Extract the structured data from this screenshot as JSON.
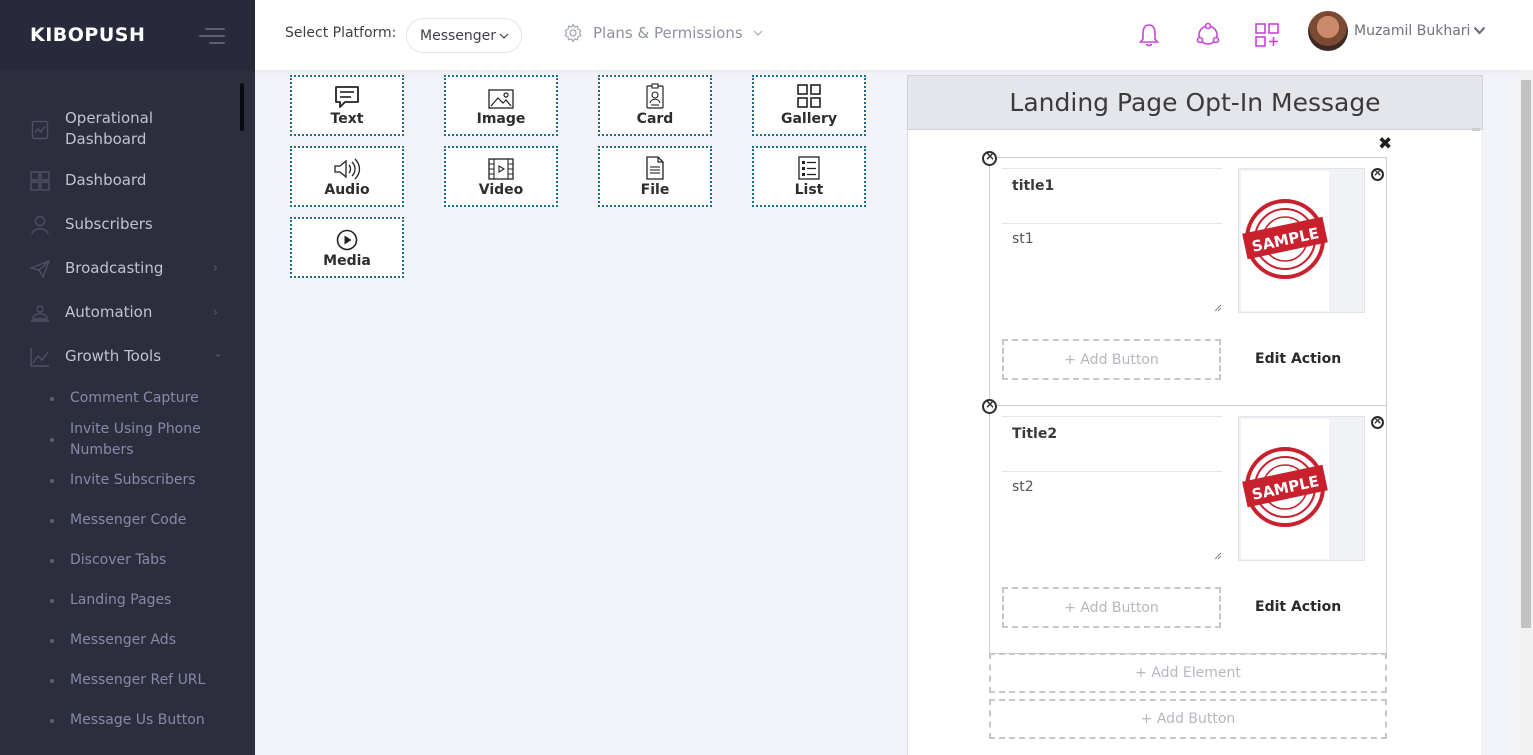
{
  "app": {
    "brand": "KIBOPUSH"
  },
  "sidebar": {
    "items": [
      {
        "label": "Operational Dashboard",
        "icon": "report-icon",
        "has_arrow": false
      },
      {
        "label": "Dashboard",
        "icon": "dashboard-grid-icon",
        "has_arrow": false
      },
      {
        "label": "Subscribers",
        "icon": "user-icon",
        "has_arrow": false
      },
      {
        "label": "Broadcasting",
        "icon": "paper-plane-icon",
        "has_arrow": true,
        "arrow": "›"
      },
      {
        "label": "Automation",
        "icon": "robot-icon",
        "has_arrow": true,
        "arrow": "›"
      },
      {
        "label": "Growth Tools",
        "icon": "chart-line-icon",
        "has_arrow": true,
        "arrow": "⌄"
      }
    ],
    "sub_items": [
      "Comment Capture",
      "Invite Using Phone Numbers",
      "Invite Subscribers",
      "Messenger Code",
      "Discover Tabs",
      "Landing Pages",
      "Messenger Ads",
      "Messenger Ref URL",
      "Message Us Button"
    ]
  },
  "header": {
    "platform_label": "Select Platform:",
    "platform_value": "Messenger",
    "plans_label": "Plans & Permissions",
    "user_name": "Muzamil Bukhari",
    "accent": "#c844db"
  },
  "components": [
    {
      "label": "Text",
      "icon": "text-message-icon"
    },
    {
      "label": "Image",
      "icon": "image-icon"
    },
    {
      "label": "Card",
      "icon": "card-icon"
    },
    {
      "label": "Gallery",
      "icon": "gallery-icon"
    },
    {
      "label": "Audio",
      "icon": "audio-icon"
    },
    {
      "label": "Video",
      "icon": "video-icon"
    },
    {
      "label": "File",
      "icon": "file-icon"
    },
    {
      "label": "List",
      "icon": "list-icon"
    },
    {
      "label": "Media",
      "icon": "media-play-icon"
    }
  ],
  "preview": {
    "title": "Landing Page Opt-In Message",
    "close": "✖",
    "cards": [
      {
        "title": "title1",
        "subtitle": "st1",
        "add_button": "+ Add Button",
        "edit_action": "Edit Action",
        "image_text": "SAMPLE"
      },
      {
        "title": "Title2",
        "subtitle": "st2",
        "add_button": "+ Add Button",
        "edit_action": "Edit Action",
        "image_text": "SAMPLE"
      }
    ],
    "add_element": "+ Add Element",
    "add_button": "+ Add Button"
  }
}
